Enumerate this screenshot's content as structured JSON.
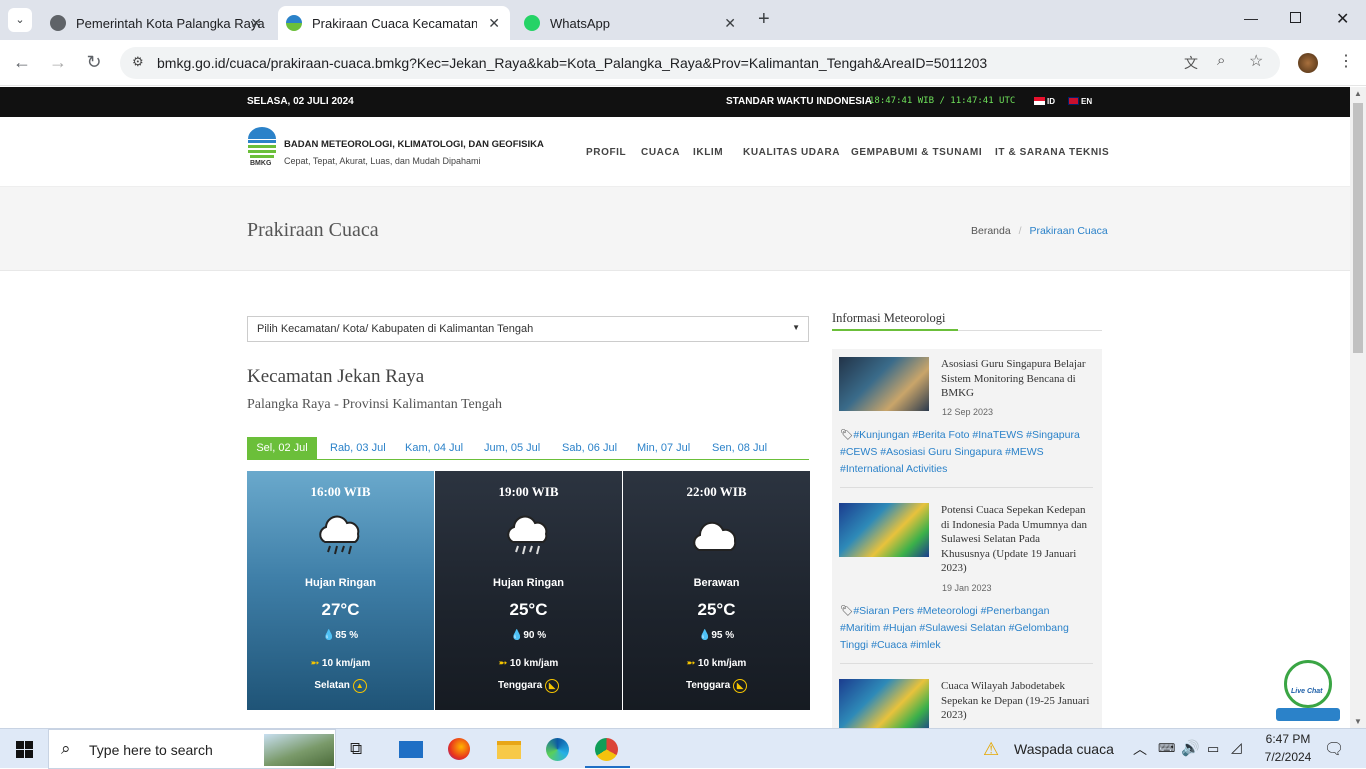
{
  "browser": {
    "tabs": [
      {
        "title": "Pemerintah Kota Palangka Raya",
        "active": false
      },
      {
        "title": "Prakiraan Cuaca Kecamatan Jek",
        "active": true
      },
      {
        "title": "WhatsApp",
        "active": false
      }
    ],
    "url": "bmkg.go.id/cuaca/prakiraan-cuaca.bmkg?Kec=Jekan_Raya&kab=Kota_Palangka_Raya&Prov=Kalimantan_Tengah&AreaID=5011203"
  },
  "topbar": {
    "date": "SELASA, 02 JULI 2024",
    "time_label": "STANDAR WAKTU INDONESIA",
    "clock": "18:47:41 WIB / 11:47:41 UTC",
    "lang_id": "ID",
    "lang_en": "EN"
  },
  "header": {
    "logo_text": "BMKG",
    "org_name": "BADAN METEOROLOGI, KLIMATOLOGI, DAN GEOFISIKA",
    "tagline": "Cepat, Tepat, Akurat, Luas, dan Mudah Dipahami",
    "menu": [
      "PROFIL",
      "CUACA",
      "IKLIM",
      "KUALITAS UDARA",
      "GEMPABUMI & TSUNAMI",
      "IT & SARANA TEKNIS"
    ]
  },
  "page": {
    "title": "Prakiraan Cuaca",
    "breadcrumb_home": "Beranda",
    "breadcrumb_current": "Prakiraan Cuaca"
  },
  "main": {
    "select_placeholder": "Pilih Kecamatan/ Kota/ Kabupaten di Kalimantan Tengah",
    "district": "Kecamatan Jekan Raya",
    "region": "Palangka Raya - Provinsi Kalimantan Tengah",
    "days": [
      "Sel, 02 Jul",
      "Rab, 03 Jul",
      "Kam, 04 Jul",
      "Jum, 05 Jul",
      "Sab, 06 Jul",
      "Min, 07 Jul",
      "Sen, 08 Jul"
    ],
    "forecasts": [
      {
        "time": "16:00 WIB",
        "condition": "Hujan Ringan",
        "temp": "27°C",
        "humidity": "85 %",
        "wind": "10 km/jam",
        "direction": "Selatan"
      },
      {
        "time": "19:00 WIB",
        "condition": "Hujan Ringan",
        "temp": "25°C",
        "humidity": "90 %",
        "wind": "10 km/jam",
        "direction": "Tenggara"
      },
      {
        "time": "22:00 WIB",
        "condition": "Berawan",
        "temp": "25°C",
        "humidity": "95 %",
        "wind": "10 km/jam",
        "direction": "Tenggara"
      }
    ]
  },
  "sidebar": {
    "heading": "Informasi Meteorologi",
    "news": [
      {
        "title": "Asosiasi Guru Singapura Belajar Sistem Monitoring Bencana di BMKG",
        "date": "12 Sep 2023",
        "tags": "#Kunjungan #Berita Foto #InaTEWS #Singapura #CEWS #Asosiasi Guru Singapura #MEWS #International Activities"
      },
      {
        "title": "Potensi Cuaca Sepekan Kedepan di Indonesia Pada Umumnya dan Sulawesi Selatan Pada Khususnya (Update 19 Januari 2023)",
        "date": "19 Jan 2023",
        "tags": "#Siaran Pers #Meteorologi #Penerbangan #Maritim #Hujan #Sulawesi Selatan #Gelombang Tinggi #Cuaca #imlek"
      },
      {
        "title": "Cuaca Wilayah Jabodetabek Sepekan ke Depan (19-25 Januari 2023)",
        "date": "",
        "tags": ""
      }
    ],
    "livechat": "Live Chat"
  },
  "taskbar": {
    "search_placeholder": "Type here to search",
    "weather": "Waspada cuaca",
    "time": "6:47 PM",
    "date": "7/2/2024"
  }
}
